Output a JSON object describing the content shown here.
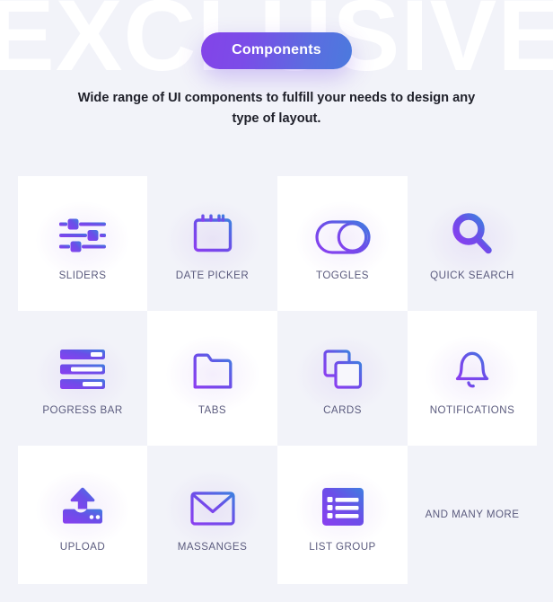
{
  "hero": {
    "watermark": "EXCLUSIVE",
    "badge_label": "Components",
    "subtitle": "Wide range of UI components to fulfill your needs to design any type of layout."
  },
  "theme": {
    "page_background": "#f2f3f9",
    "tile_highlight": "#ffffff",
    "gradient_start": "#8344e8",
    "gradient_end": "#4b7ade",
    "label_color": "#5b5b7e",
    "subtitle_color": "#20212b"
  },
  "grid": {
    "columns": 4,
    "rows": 3,
    "items": [
      {
        "label": "SLIDERS",
        "icon": "sliders-icon",
        "highlighted": true
      },
      {
        "label": "DATE PICKER",
        "icon": "calendar-icon",
        "highlighted": false
      },
      {
        "label": "TOGGLES",
        "icon": "toggle-icon",
        "highlighted": true
      },
      {
        "label": "QUICK SEARCH",
        "icon": "search-icon",
        "highlighted": false
      },
      {
        "label": "POGRESS BAR",
        "icon": "progress-bar-icon",
        "highlighted": false
      },
      {
        "label": "TABS",
        "icon": "folder-icon",
        "highlighted": true
      },
      {
        "label": "CARDS",
        "icon": "cards-icon",
        "highlighted": false
      },
      {
        "label": "NOTIFICATIONS",
        "icon": "bell-icon",
        "highlighted": true
      },
      {
        "label": "UPLOAD",
        "icon": "upload-icon",
        "highlighted": true
      },
      {
        "label": "MASSANGES",
        "icon": "envelope-icon",
        "highlighted": false
      },
      {
        "label": "LIST GROUP",
        "icon": "list-group-icon",
        "highlighted": true
      },
      {
        "label": "AND MANY MORE",
        "icon": "none",
        "highlighted": false
      }
    ]
  }
}
